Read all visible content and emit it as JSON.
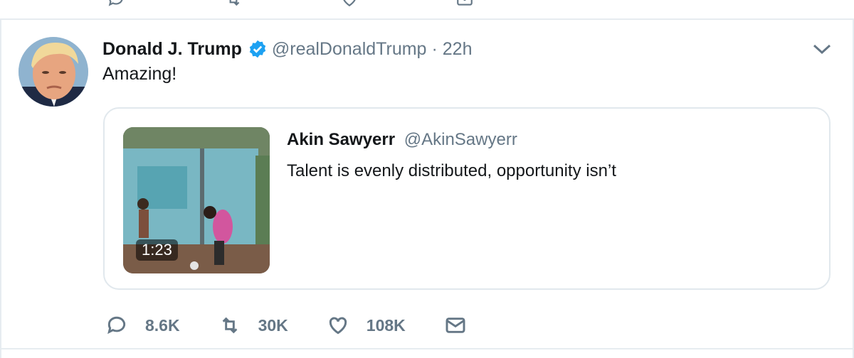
{
  "tweet": {
    "author_name": "Donald J. Trump",
    "author_handle": "@realDonaldTrump",
    "separator": "·",
    "time": "22h",
    "text": "Amazing!",
    "verified": true
  },
  "quoted_tweet": {
    "author_name": "Akin Sawyerr",
    "author_handle": "@AkinSawyerr",
    "text": "Talent is evenly distributed, opportunity isn’t",
    "video_duration": "1:23"
  },
  "actions": {
    "reply_count": "8.6K",
    "retweet_count": "30K",
    "like_count": "108K"
  },
  "icons": {
    "reply": "reply-icon",
    "retweet": "retweet-icon",
    "like": "heart-icon",
    "dm": "envelope-icon",
    "caret": "chevron-down-icon",
    "verified": "verified-badge-icon"
  },
  "colors": {
    "text": "#14171a",
    "secondary": "#657786",
    "verified_blue": "#1da1f2",
    "border": "#e6ecf0"
  }
}
